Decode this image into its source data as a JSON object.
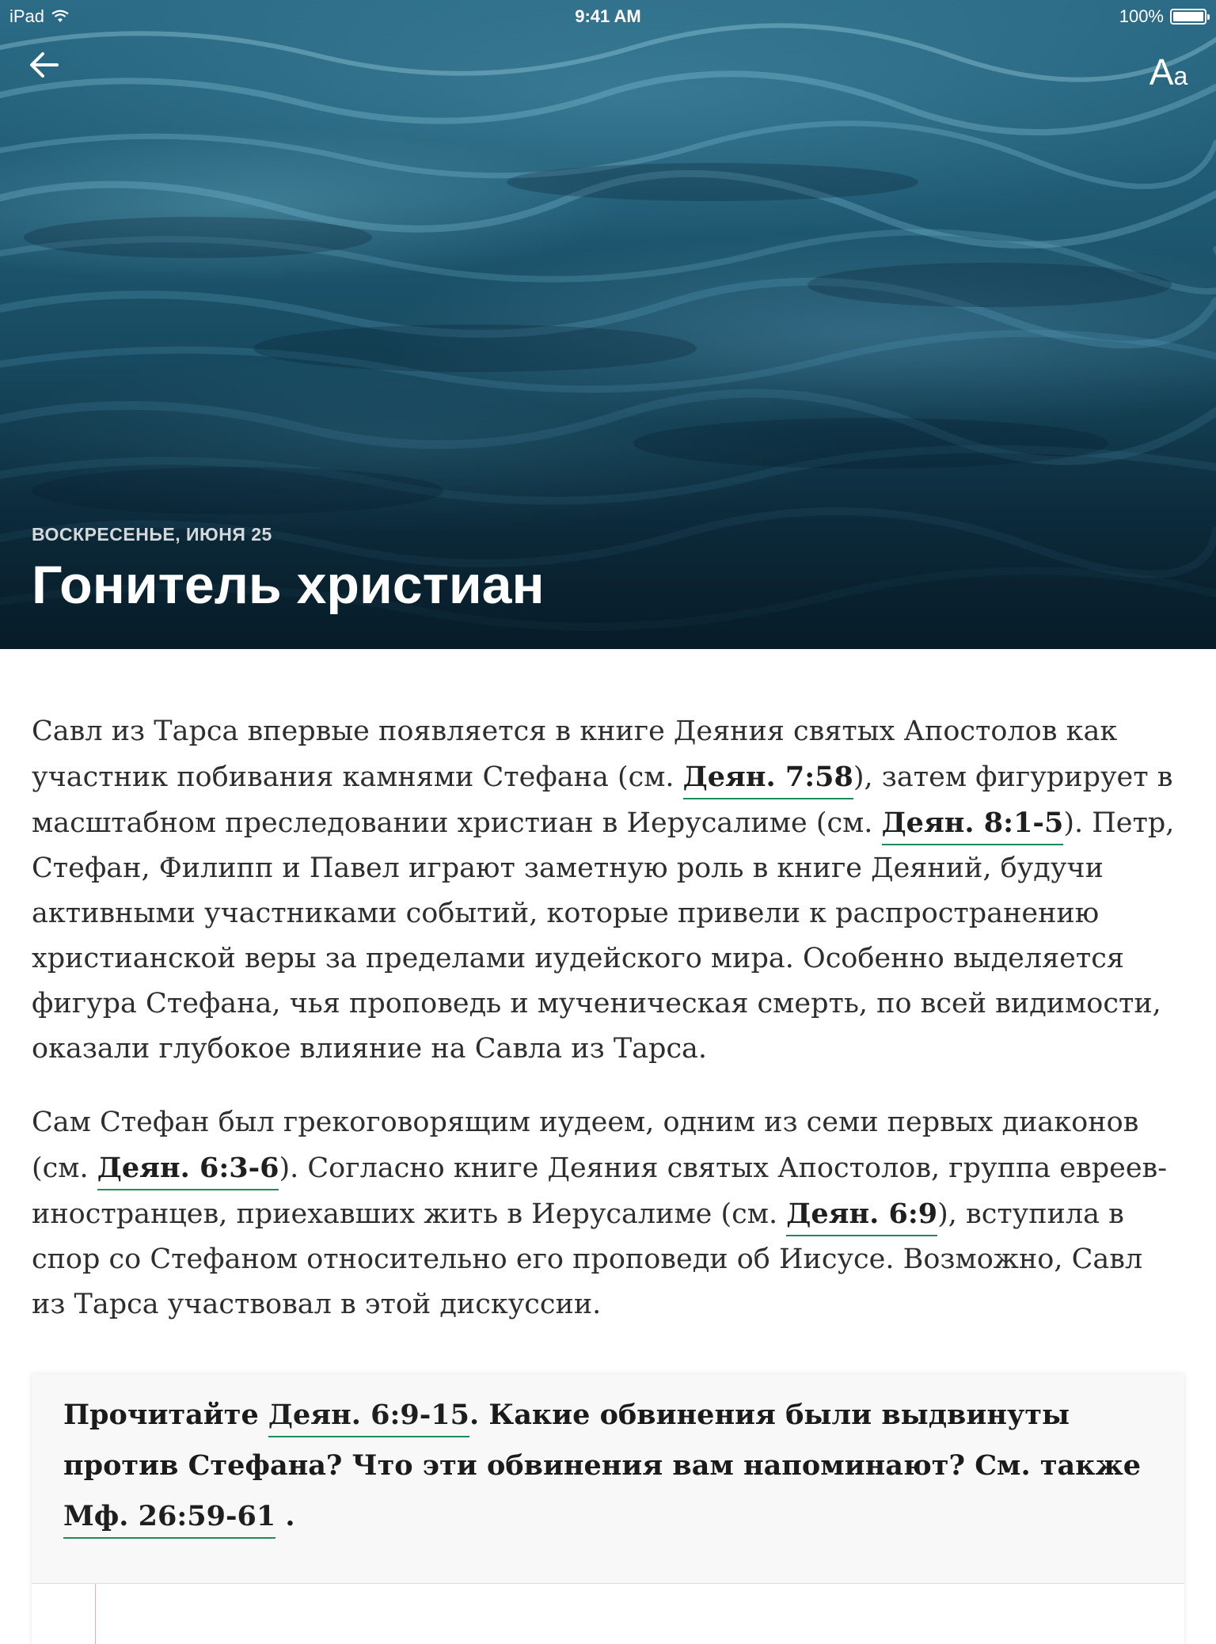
{
  "status_bar": {
    "device": "iPad",
    "time": "9:41 AM",
    "battery": "100%"
  },
  "header": {
    "back_icon": "arrow-left-icon",
    "font_button_big": "A",
    "font_button_small": "a",
    "date": "ВОСКРЕСЕНЬЕ, ИЮНЯ 25",
    "title": "Гонитель христиан"
  },
  "paragraph1": {
    "t1": "Савл из Тарса впервые появляется в книге Деяния святых Апостолов как участник побивания камнями Стефана (см. ",
    "ref1": "Деян. 7:58",
    "t2": "), затем фигурирует в масштабном преследовании христиан в Иерусалиме (см. ",
    "ref2": "Деян. 8:1-5",
    "t3": "). Петр, Стефан, Филипп и Павел играют заметную роль в книге Деяний, будучи активными участниками событий, которые привели к распространению христианской веры за пределами иудейского мира. Особенно выделяется фигура Стефана, чья проповедь и мученическая смерть, по всей видимости, оказали глубокое влияние на Савла из Тарса."
  },
  "paragraph2": {
    "t1": "Сам Стефан был грекоговорящим иудеем, одним из семи первых диаконов (см. ",
    "ref1": "Деян. 6:3-6",
    "t2": "). Согласно книге Деяния святых Апостолов, группа евреев-иностранцев, приехавших жить в Иерусалиме (см. ",
    "ref2": "Деян. 6:9",
    "t3": "), вступила в спор со Стефаном относительно его проповеди об Иисусе. Возможно, Савл из Тарса участвовал в этой дискуссии."
  },
  "question": {
    "t1": "Прочитайте ",
    "ref1": "Деян. 6:9-15",
    "t2": ". Какие обвинения были выдвинуты против Стефана? Что эти обвинения вам напоминают? См. также ",
    "ref2": "Мф. 26:59-61",
    "t3": " ."
  },
  "colors": {
    "link_underline": "#1f8a5a",
    "answer_margin": "#f1a9a9"
  }
}
